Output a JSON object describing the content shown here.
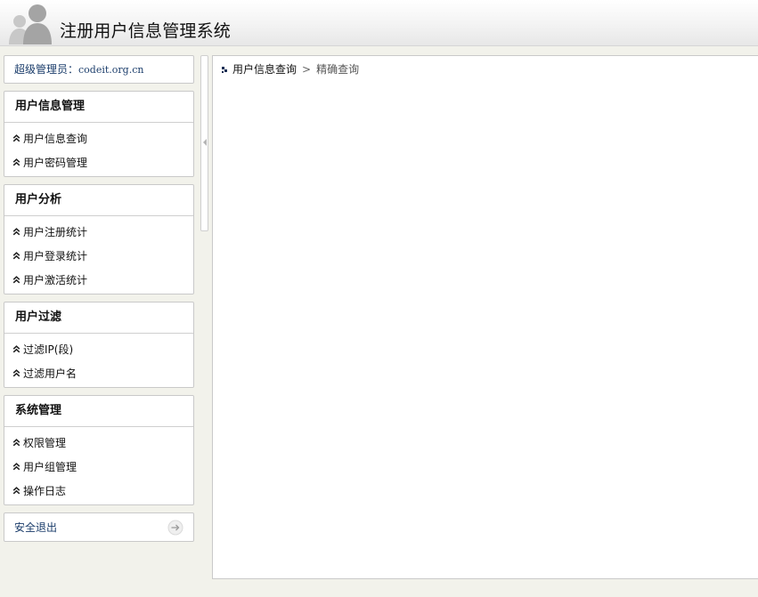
{
  "app": {
    "title": "注册用户信息管理系统"
  },
  "sidebar": {
    "admin": {
      "label": "超级管理员：",
      "name": "codeit.org.cn"
    },
    "panels": [
      {
        "title": "用户信息管理",
        "items": [
          {
            "label": "用户信息查询"
          },
          {
            "label": "用户密码管理"
          }
        ]
      },
      {
        "title": "用户分析",
        "items": [
          {
            "label": "用户注册统计"
          },
          {
            "label": "用户登录统计"
          },
          {
            "label": "用户激活统计"
          }
        ]
      },
      {
        "title": "用户过滤",
        "items": [
          {
            "label": "过滤IP(段)"
          },
          {
            "label": "过滤用户名"
          }
        ]
      },
      {
        "title": "系统管理",
        "items": [
          {
            "label": "权限管理"
          },
          {
            "label": "用户组管理"
          },
          {
            "label": "操作日志"
          }
        ]
      }
    ],
    "logout": {
      "label": "安全退出",
      "icon": "arrow-right-icon"
    }
  },
  "breadcrumb": {
    "root": "用户信息查询",
    "separator": ">",
    "current": "精确查询"
  },
  "colors": {
    "background": "#f2f2eb",
    "link_text": "#1b3d6b",
    "panel_border": "#c9c9c9"
  }
}
